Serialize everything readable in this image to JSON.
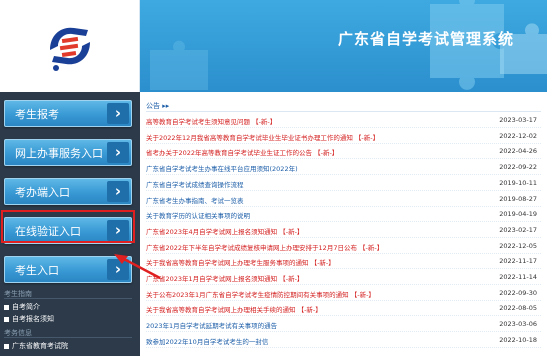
{
  "header": {
    "title": "广东省自学考试管理系统"
  },
  "sidebar": {
    "buttons": [
      {
        "label": "考生报考"
      },
      {
        "label": "网上办事服务入口"
      },
      {
        "label": "考办端入口"
      },
      {
        "label": "在线验证入口"
      },
      {
        "label": "考生入口"
      }
    ],
    "section1_title": "考生指南",
    "section1_links": [
      {
        "label": "自考简介"
      },
      {
        "label": "自考报名须知"
      }
    ],
    "section2_title": "考务信息",
    "section2_links": [
      {
        "label": "广东省教育考试院"
      }
    ]
  },
  "content": {
    "section_title": "公告 ▸▸",
    "news": [
      {
        "title": "高等教育自学考试考生须知意见问题 【-新-】",
        "date": "2023-03-17",
        "highlight": true
      },
      {
        "title": "关于2022年12月我省高等教育自学考试毕业生毕业证书办理工作的通知 【-新-】",
        "date": "2022-12-02",
        "highlight": true
      },
      {
        "title": "省考办关于2022年高等教育自学考试毕业生证工作的公告 【-新-】",
        "date": "2022-04-26",
        "highlight": true
      },
      {
        "title": "广东省自学考试考生办事在线平台应用须知(2022年)",
        "date": "2022-09-22",
        "highlight": false
      },
      {
        "title": "广东省自学考试成绩查询操作流程",
        "date": "2019-10-11",
        "highlight": false
      },
      {
        "title": "广东省考生办事指南、考试一览表",
        "date": "2019-08-27",
        "highlight": false
      },
      {
        "title": "关于教育学历的认证相关事项的说明",
        "date": "2019-04-19",
        "highlight": false
      },
      {
        "title": "广东省2023年4月自学考试网上报名须知通知 【-新-】",
        "date": "2023-02-17",
        "highlight": true
      },
      {
        "title": "广东省2022年下半年自学考试成绩复核申请网上办理安排于12月7日公布 【-新-】",
        "date": "2022-12-05",
        "highlight": true
      },
      {
        "title": "关于我省高等教育自学考试网上办理考生服务事项的通知 【-新-】",
        "date": "2022-11-17",
        "highlight": true
      },
      {
        "title": "广东省2023年1月自学考试网上报名须知通知 【-新-】",
        "date": "2022-11-14",
        "highlight": true
      },
      {
        "title": "关于公布2023年1月广东省自学考试考生疫情防控期间有关事项的通知 【-新-】",
        "date": "2022-09-30",
        "highlight": true
      },
      {
        "title": "关于我省高等教育自学考试网上办理相关手续的通知 【-新-】",
        "date": "2022-08-05",
        "highlight": true
      },
      {
        "title": "2023年1月自学考试延期考试有关事项的通告",
        "date": "2023-03-06",
        "highlight": false
      },
      {
        "title": "致参加2022年10月自学考试考生的一封信",
        "date": "2022-10-18",
        "highlight": false
      }
    ]
  },
  "colors": {
    "banner": "#2b8fcd",
    "sidebar": "#2c3a4a",
    "highlight_red": "#e02020",
    "link_blue": "#1d5ea8"
  }
}
